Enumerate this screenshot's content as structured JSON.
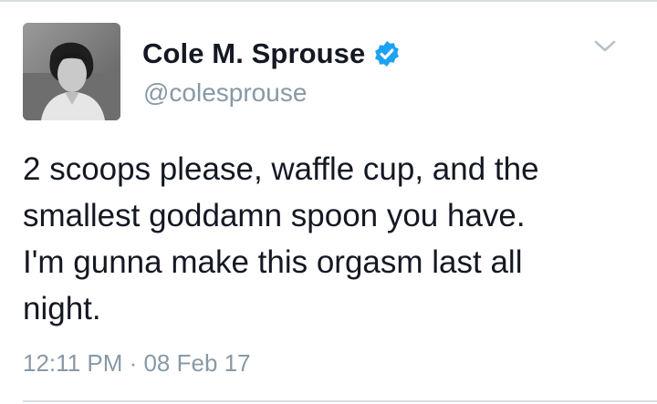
{
  "tweet": {
    "author": {
      "display_name": "Cole M. Sprouse",
      "handle": "@colesprouse",
      "verified": true,
      "avatar_icon": "profile-photo-avatar"
    },
    "text": "2 scoops please, waffle cup, and the\nsmallest goddamn spoon you have.\nI'm gunna make this orgasm last all\nnight.",
    "timestamp": "12:11 PM · 08 Feb 17",
    "menu_icon": "chevron-down-icon"
  },
  "colors": {
    "verified_badge": "#1da1f2",
    "primary_text": "#141823",
    "secondary_text": "#8899a6",
    "divider": "#d9dde1"
  }
}
